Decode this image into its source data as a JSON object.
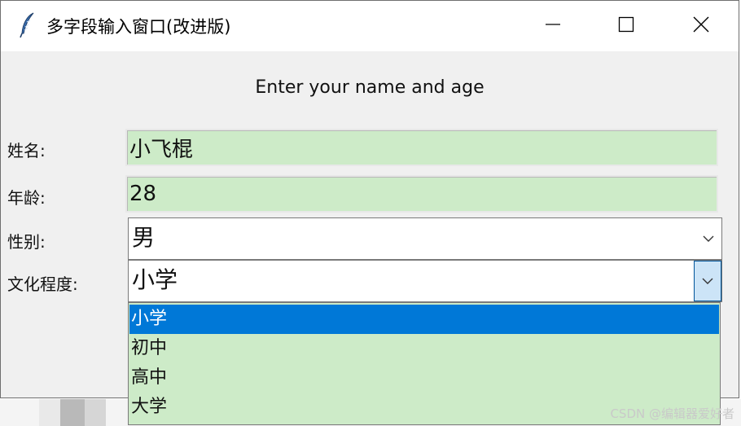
{
  "window": {
    "title": "多字段输入窗口(改进版)",
    "header": "Enter your name and age"
  },
  "fields": {
    "name_label": "姓名:",
    "name_value": "小飞棍",
    "age_label": "年龄:",
    "age_value": "28",
    "gender_label": "性别:",
    "gender_value": "男",
    "education_label": "文化程度:",
    "education_value": "小学"
  },
  "dropdown": {
    "options": [
      "小学",
      "初中",
      "高中",
      "大学"
    ],
    "selected_index": 0
  },
  "colors": {
    "entry_bg": "#cdebc8",
    "selection": "#0078d7",
    "window_bg": "#f0f0f0"
  },
  "watermark": "CSDN @编辑器爱好者"
}
